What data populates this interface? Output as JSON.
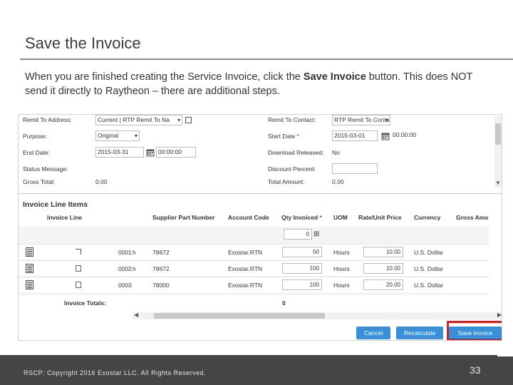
{
  "slide": {
    "title": "Save the Invoice",
    "body_text_1": "When you are finished creating the Service Invoice, click the ",
    "body_bold": "Save Invoice",
    "body_text_2": " button.  This does NOT send it directly to Raytheon – there are additional steps."
  },
  "form": {
    "remit_to_address_label": "Remit To Address:",
    "remit_to_address_value": "Current | RTP Remit To Na",
    "remit_to_contact_label": "Remit To Contact:",
    "remit_to_contact_value": "RTP Remit To Conta",
    "purpose_label": "Purpose:",
    "purpose_value": "Original",
    "start_date_label": "Start Date",
    "start_date_value": "2015-03-01",
    "start_time_value": "00:00:00",
    "end_date_label": "End Date:",
    "end_date_value": "2015-03-31",
    "end_time_value": "00:00:00",
    "download_released_label": "Download Released:",
    "download_released_value": "No",
    "status_message_label": "Status Message:",
    "discount_percent_label": "Discount Percent:",
    "gross_total_label": "Gross Total:",
    "gross_total_value": "0.00",
    "total_amount_label": "Total Amount:",
    "total_amount_value": "0.00"
  },
  "line_items": {
    "section_title": "Invoice Line Items",
    "columns": [
      "Invoice Line",
      "Supplier Part Number",
      "Account Code",
      "Qty Invoiced",
      "UOM",
      "Rate/Unit Price",
      "Currency",
      "Gross Amo"
    ],
    "filter_value": "0",
    "rows": [
      {
        "line": "0001",
        "part": "78672",
        "account": "Exostar.RTN",
        "qty": "50",
        "uom": "Hours",
        "rate": "10.00",
        "currency": "U.S. Dollar"
      },
      {
        "line": "0002",
        "part": "78672",
        "account": "Exostar.RTN",
        "qty": "100",
        "uom": "Hours",
        "rate": "10.00",
        "currency": "U.S. Dollar"
      },
      {
        "line": "0003",
        "part": "78000",
        "account": "Exostar.RTN",
        "qty": "100",
        "uom": "Hours",
        "rate": "20.00",
        "currency": "U.S. Dollar"
      }
    ],
    "totals_label": "Invoice Totals:",
    "totals_qty": "0"
  },
  "buttons": {
    "cancel": "Cancel",
    "recalculate": "Recalculate",
    "save_invoice": "Save Invoice"
  },
  "footer": {
    "copyright": "RSCP: Copyright 2016 Exostar LLC. All Rights Reserved.",
    "page_number": "33"
  },
  "colors": {
    "button_blue": "#3a8fd6",
    "highlight_red": "#d42020",
    "footer_gray": "#454545"
  }
}
